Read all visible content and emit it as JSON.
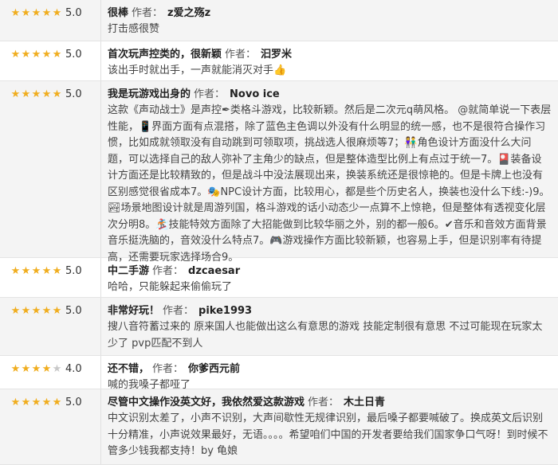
{
  "reviews": [
    {
      "rating": 5,
      "score": "5.0",
      "title": "很棒",
      "author_label": "作者：",
      "author": "z爱之殇z",
      "body": "打击感很赞"
    },
    {
      "rating": 5,
      "score": "5.0",
      "title": "首次玩声控类的，很新颖",
      "author_label": "作者：",
      "author": "汩罗米",
      "body": "该出手时就出手，一声就能消灭对手👍"
    },
    {
      "rating": 5,
      "score": "5.0",
      "title": "我是玩游戏出身的",
      "author_label": "作者：",
      "author": "Novo ice",
      "body": "这款《声动战士》是声控✒类格斗游戏，比较新颖。然后是二次元q萌风格。 @就简单说一下表层性能，📱界面方面有点混搭，除了蓝色主色调以外没有什么明显的统一感，也不是很符合操作习惯，比如成就领取没有自动跳到可领取项，挑战选人很麻烦等7；👫角色设计方面没什么大问题，可以选择自己的敌人弥补了主角少的缺点，但是整体造型比例上有点过于统一7。🎴装备设计方面还是比较精致的，但是战斗中没法展现出来，换装系统还是很惊艳的。但是卡牌上也没有区别感觉很省成本7。🎭NPC设计方面，比较用心，都是些个历史名人，换装也没什么下线:-)9。🏞场景地图设计就是周游列国，格斗游戏的话小动态少一点算不上惊艳，但是整体有透视变化层次分明8。🏂技能特效方面除了大招能做到比较华丽之外，别的都一般6。✔音乐和音效方面背景音乐挺洗脑的，音效没什么特点7。🎮游戏操作方面比较新颖，也容易上手，但是识别率有待提高，还需要玩家选择场合9。"
    },
    {
      "rating": 5,
      "score": "5.0",
      "title": "中二手游",
      "author_label": "作者：",
      "author": "dzcaesar",
      "body": "哈哈，只能躲起来偷偷玩了"
    },
    {
      "rating": 5,
      "score": "5.0",
      "title": "非常好玩！",
      "author_label": "作者：",
      "author": "pike1993",
      "body": "搜八音符蓄过来的 原来国人也能做出这么有意思的游戏 技能定制很有意思 不过可能现在玩家太少了 pvp匹配不到人"
    },
    {
      "rating": 4,
      "score": "4.0",
      "title": "还不错，",
      "author_label": "作者：",
      "author": "你爹西元前",
      "body": "喊的我嗓子都哑了"
    },
    {
      "rating": 5,
      "score": "5.0",
      "title": "尽管中文操作没英文好，我依然爱这款游戏",
      "author_label": "作者：",
      "author": "木土日青",
      "body": "中文识别太差了，小声不识别，大声间歇性无规律识别，最后嗓子都要喊破了。换成英文后识别十分精准，小声说效果最好，无语。。。。希望咱们中国的开发者要给我们国家争口气呀！到时候不管多少钱我都支持！by 龟娘"
    }
  ],
  "colors": {
    "star_filled": "#f0ad1e",
    "star_empty": "#c8c8c8",
    "row_alt_bg": "#f4f4f4"
  },
  "icons": {
    "star": "star-icon"
  }
}
